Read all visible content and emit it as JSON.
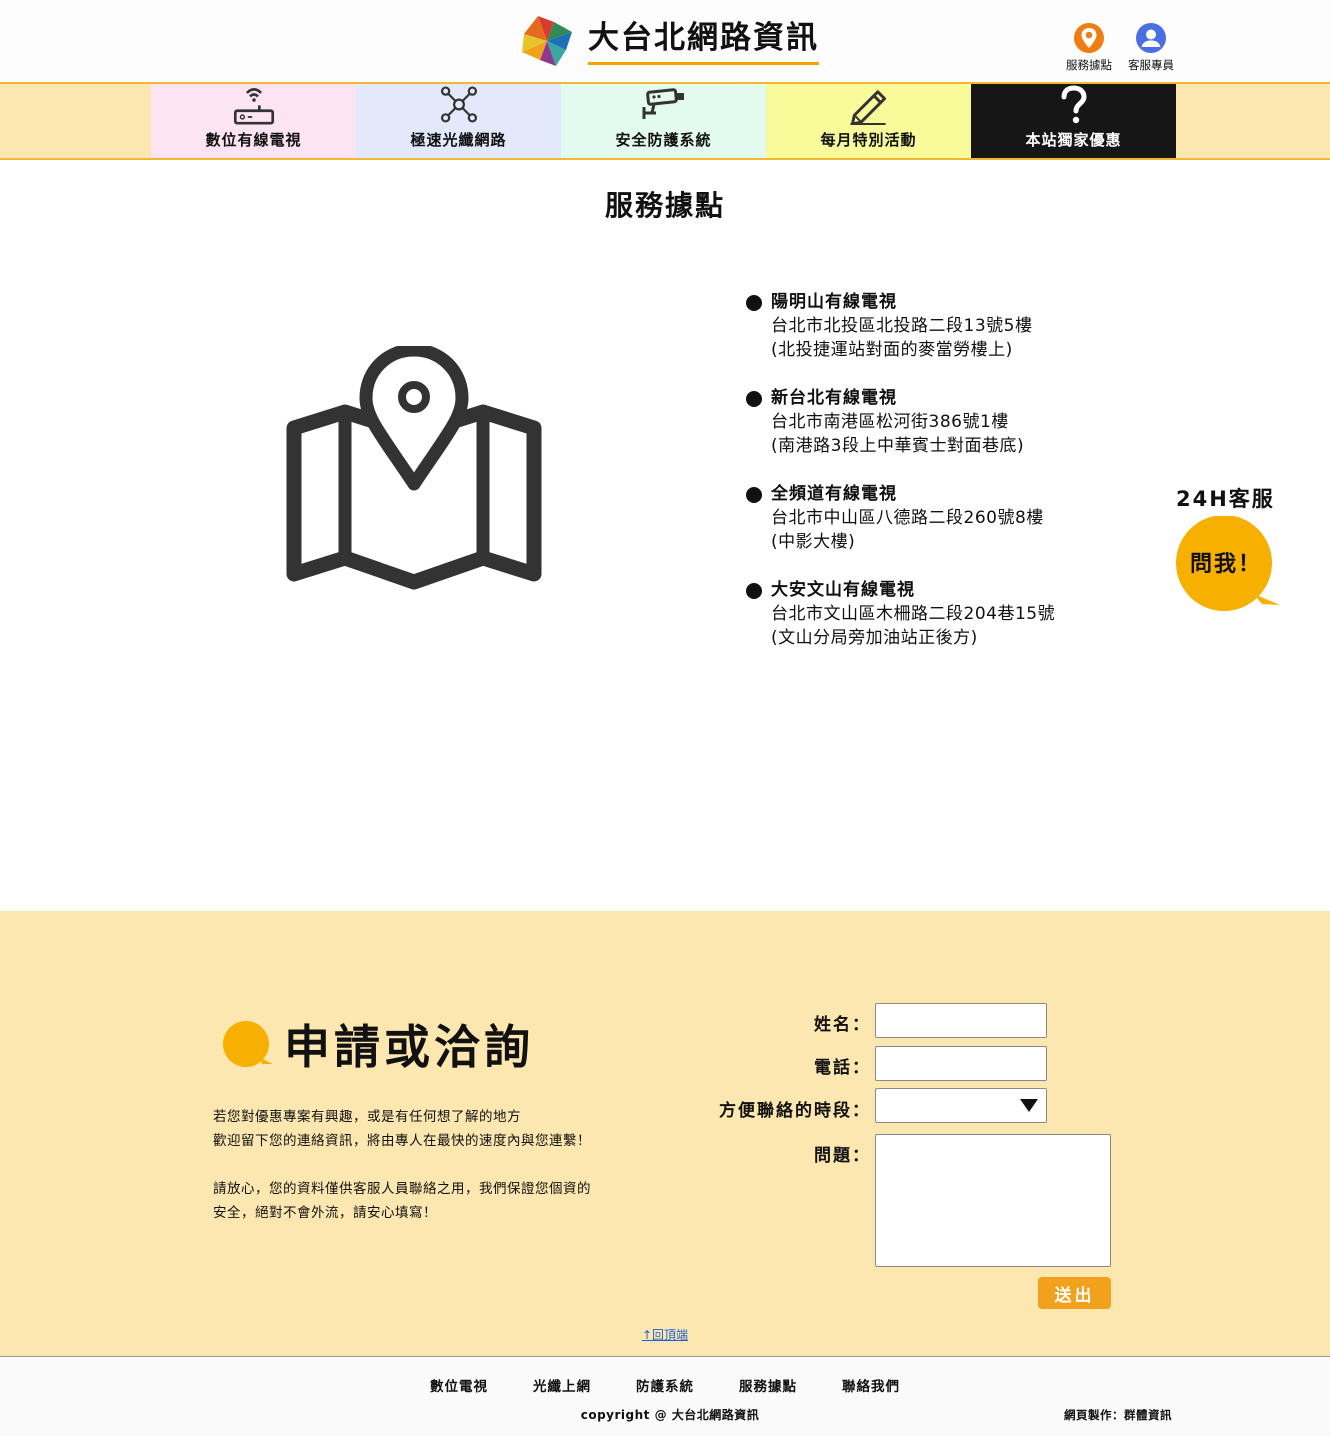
{
  "header": {
    "site_title": "大台北網路資訊",
    "top_links": [
      {
        "label": "服務據點",
        "icon": "location-pin-icon",
        "color": "#ef7d11"
      },
      {
        "label": "客服專員",
        "icon": "user-icon",
        "color": "#4a6fe3"
      }
    ]
  },
  "nav": {
    "items": [
      {
        "label": "數位有線電視",
        "icon": "router-icon",
        "bg": "#fde4f3"
      },
      {
        "label": "極速光纖網路",
        "icon": "network-icon",
        "bg": "#e3e8fb"
      },
      {
        "label": "安全防護系統",
        "icon": "cctv-camera-icon",
        "bg": "#e3fbef"
      },
      {
        "label": "每月特別活動",
        "icon": "pencil-icon",
        "bg": "#f9fb9b"
      },
      {
        "label": "本站獨家優惠",
        "icon": "question-icon",
        "bg": "#161616"
      }
    ]
  },
  "main": {
    "title": "服務據點",
    "locations": [
      {
        "name": "陽明山有線電視",
        "address": "台北市北投區北投路二段13號5樓",
        "note": "(北投捷運站對面的麥當勞樓上)"
      },
      {
        "name": "新台北有線電視",
        "address": "台北市南港區松河街386號1樓",
        "note": "(南港路3段上中華賓士對面巷底)"
      },
      {
        "name": "全頻道有線電視",
        "address": "台北市中山區八德路二段260號8樓",
        "note": "(中影大樓)"
      },
      {
        "name": "大安文山有線電視",
        "address": "台北市文山區木柵路二段204巷15號",
        "note": "(文山分局旁加油站正後方)"
      }
    ]
  },
  "support": {
    "title": "24H客服",
    "bubble": "問我！",
    "color": "#f7b000"
  },
  "apply": {
    "title": "申請或洽詢",
    "desc_lines_1": [
      "若您對優惠專案有興趣，或是有任何想了解的地方",
      "歡迎留下您的連絡資訊，將由專人在最快的速度內與您連繫！"
    ],
    "desc_lines_2": [
      "請放心，您的資料僅供客服人員聯絡之用，我們保證您個資的",
      "安全，絕對不會外流，請安心填寫！"
    ],
    "form": {
      "name_label": "姓名：",
      "phone_label": "電話：",
      "time_label": "方便聯絡的時段：",
      "question_label": "問題：",
      "name_value": "",
      "phone_value": "",
      "time_value": "",
      "question_value": "",
      "submit_label": "送出"
    },
    "back_to_top": "↑回頂端",
    "bg": "#fde7b0"
  },
  "footer": {
    "links": [
      "數位電視",
      "光纖上網",
      "防護系統",
      "服務據點",
      "聯絡我們"
    ],
    "copyright": "copyright @ 大台北網路資訊",
    "credit": "網頁製作：群體資訊"
  }
}
